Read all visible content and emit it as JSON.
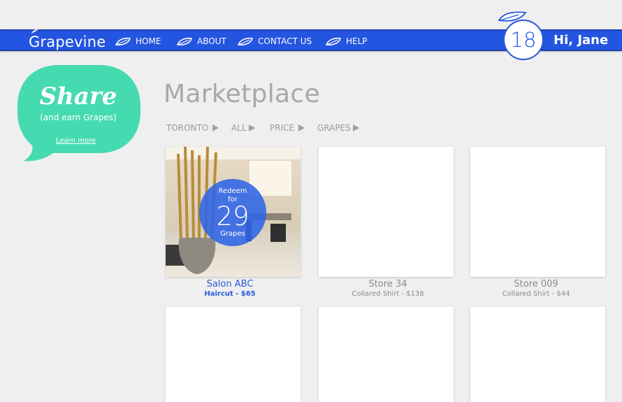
{
  "brand": {
    "name": "Grapevine"
  },
  "nav": {
    "items": [
      {
        "label": "HOME"
      },
      {
        "label": "ABOUT"
      },
      {
        "label": "CONTACT US"
      },
      {
        "label": "HELP"
      }
    ]
  },
  "user": {
    "grapes": "18",
    "greeting": "Hi, Jane"
  },
  "share": {
    "title": "Share",
    "subtitle": "(and earn Grapes)",
    "link": "Learn more"
  },
  "page": {
    "title": "Marketplace"
  },
  "filters": [
    {
      "label": "TORONTO"
    },
    {
      "label": "ALL"
    },
    {
      "label": "PRICE"
    },
    {
      "label": "GRAPES"
    }
  ],
  "cards": [
    {
      "name": "Salon ABC",
      "sub": "Haircut - $65",
      "redeem_top": "Redeem",
      "redeem_for": "for",
      "redeem_value": "29",
      "redeem_unit": "Grapes"
    },
    {
      "name": "Store 34",
      "sub": "Collared Shirt - $138"
    },
    {
      "name": "Store 009",
      "sub": "Collared Shirt - $44"
    }
  ],
  "colors": {
    "brand_blue": "#2455e0",
    "share_green": "#46dab1",
    "title_gray": "#a8a8a8"
  },
  "icons": {
    "nav_leaf": "leaf-icon",
    "filter_arrow": "triangle-right-icon"
  }
}
